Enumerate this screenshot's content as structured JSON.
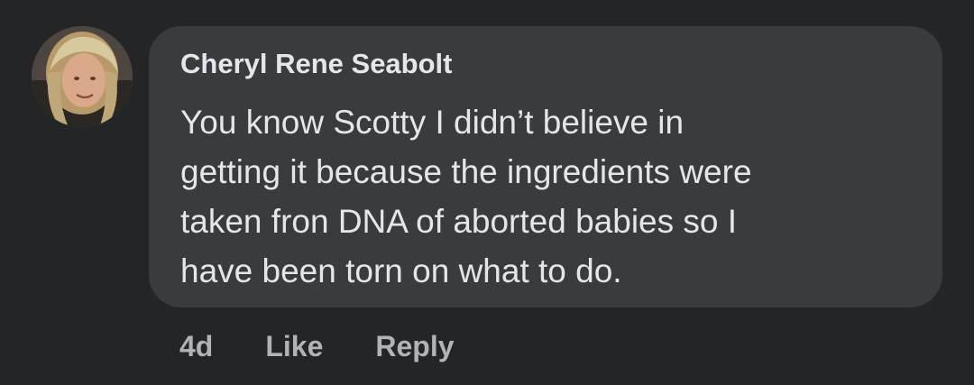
{
  "comment": {
    "author": "Cheryl Rene Seabolt",
    "text_lines": [
      "You know Scotty I didn’t believe in",
      "getting it because the ingredients were",
      "taken fron DNA of aborted babies so I",
      "have been torn on what to do."
    ],
    "timestamp": "4d",
    "like_label": "Like",
    "reply_label": "Reply"
  },
  "colors": {
    "background": "#242526",
    "bubble": "#3a3b3c",
    "primary_text": "#e4e6eb",
    "secondary_text": "#b0b3b8"
  }
}
